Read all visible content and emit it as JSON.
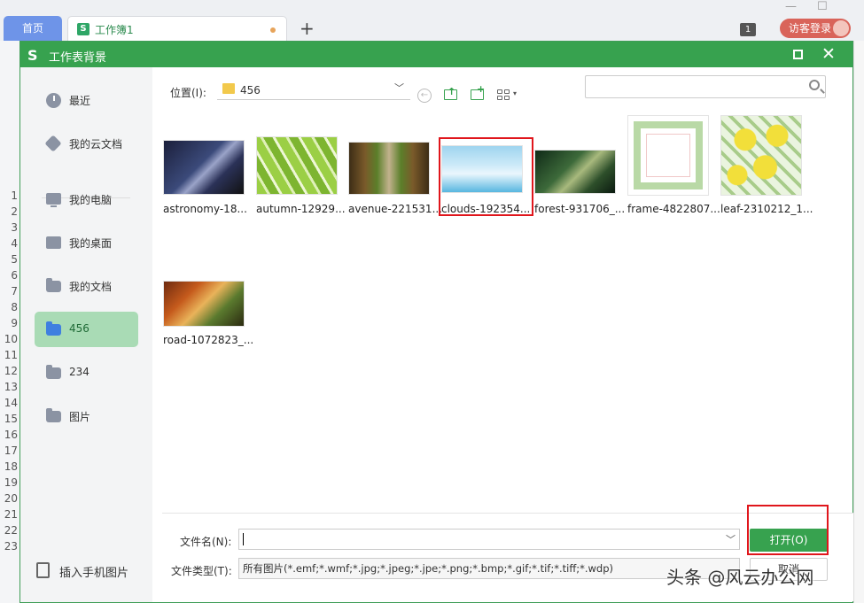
{
  "tabs": {
    "home": "首页",
    "workbook": "工作簿1",
    "add": "+"
  },
  "topbar": {
    "badge": "1",
    "login": "访客登录"
  },
  "row_numbers": [
    "1",
    "2",
    "3",
    "4",
    "5",
    "6",
    "7",
    "8",
    "9",
    "10",
    "11",
    "12",
    "13",
    "14",
    "15",
    "16",
    "17",
    "18",
    "19",
    "20",
    "21",
    "22",
    "23"
  ],
  "dialog": {
    "title": "工作表背景",
    "logo": "S",
    "sidebar": {
      "items": [
        {
          "label": "最近"
        },
        {
          "label": "我的云文档"
        },
        {
          "label": "我的电脑"
        },
        {
          "label": "我的桌面"
        },
        {
          "label": "我的文档"
        },
        {
          "label": "456"
        },
        {
          "label": "234"
        },
        {
          "label": "图片"
        }
      ],
      "bottom": "插入手机图片"
    },
    "toolbar": {
      "location_label": "位置(I):",
      "location_value": "456",
      "search_placeholder": ""
    },
    "files": [
      {
        "name": "astronomy-18..."
      },
      {
        "name": "autumn-12929..."
      },
      {
        "name": "avenue-221531..."
      },
      {
        "name": "clouds-192354..."
      },
      {
        "name": "forest-931706_..."
      },
      {
        "name": "frame-4822807..."
      },
      {
        "name": "leaf-2310212_1..."
      },
      {
        "name": "road-1072823_..."
      }
    ],
    "footer": {
      "filename_label": "文件名(N):",
      "filename_value": "",
      "filetype_label": "文件类型(T):",
      "filetype_value": "所有图片(*.emf;*.wmf;*.jpg;*.jpeg;*.jpe;*.png;*.bmp;*.gif;*.tif;*.tiff;*.wdp)",
      "open_button": "打开(O)",
      "cancel_button": "取消"
    }
  },
  "watermark": "头条 @风云办公网",
  "colors": {
    "accent": "#37a24f",
    "highlight": "#e0161c",
    "selected_sidebar": "#a9dbb5"
  }
}
